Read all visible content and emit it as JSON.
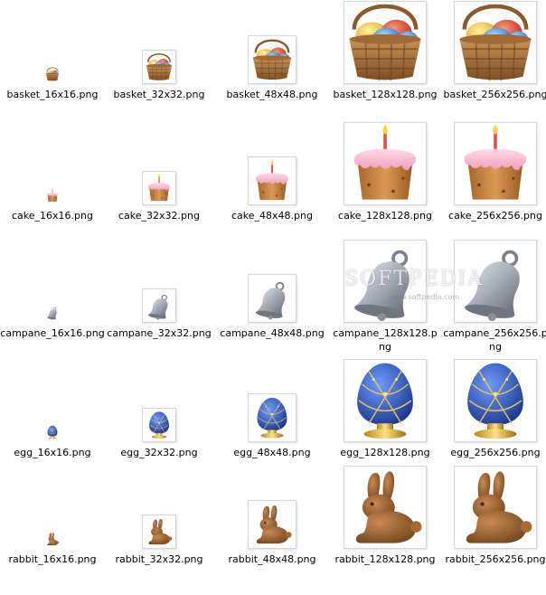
{
  "files": [
    {
      "name": "basket_16x16.png",
      "icon": "basket-icon"
    },
    {
      "name": "basket_32x32.png",
      "icon": "basket-icon"
    },
    {
      "name": "basket_48x48.png",
      "icon": "basket-icon"
    },
    {
      "name": "basket_128x128.png",
      "icon": "basket-icon"
    },
    {
      "name": "basket_256x256.png",
      "icon": "basket-icon"
    },
    {
      "name": "cake_16x16.png",
      "icon": "cake-icon"
    },
    {
      "name": "cake_32x32.png",
      "icon": "cake-icon"
    },
    {
      "name": "cake_48x48.png",
      "icon": "cake-icon"
    },
    {
      "name": "cake_128x128.png",
      "icon": "cake-icon"
    },
    {
      "name": "cake_256x256.png",
      "icon": "cake-icon"
    },
    {
      "name": "campane_16x16.png",
      "icon": "bell-icon"
    },
    {
      "name": "campane_32x32.png",
      "icon": "bell-icon"
    },
    {
      "name": "campane_48x48.png",
      "icon": "bell-icon"
    },
    {
      "name": "campane_128x128.png",
      "icon": "bell-icon"
    },
    {
      "name": "campane_256x256.png",
      "icon": "bell-icon"
    },
    {
      "name": "egg_16x16.png",
      "icon": "egg-icon"
    },
    {
      "name": "egg_32x32.png",
      "icon": "egg-icon"
    },
    {
      "name": "egg_48x48.png",
      "icon": "egg-icon"
    },
    {
      "name": "egg_128x128.png",
      "icon": "egg-icon"
    },
    {
      "name": "egg_256x256.png",
      "icon": "egg-icon"
    },
    {
      "name": "rabbit_16x16.png",
      "icon": "rabbit-icon"
    },
    {
      "name": "rabbit_32x32.png",
      "icon": "rabbit-icon"
    },
    {
      "name": "rabbit_48x48.png",
      "icon": "rabbit-icon"
    },
    {
      "name": "rabbit_128x128.png",
      "icon": "rabbit-icon"
    },
    {
      "name": "rabbit_256x256.png",
      "icon": "rabbit-icon"
    }
  ],
  "watermark": {
    "text": "SOFTPEDIA",
    "url": "www.softpedia.com"
  },
  "colors": {
    "background": "#ffffff",
    "thumbnail_border": "#d6d6d6",
    "basket_wicker": "#b07a45",
    "cake_frosting": "#f6b3c8",
    "bell_silver": "#9ea3ad",
    "egg_blue": "#2b55b8",
    "rabbit_chocolate": "#8a5a2e"
  }
}
